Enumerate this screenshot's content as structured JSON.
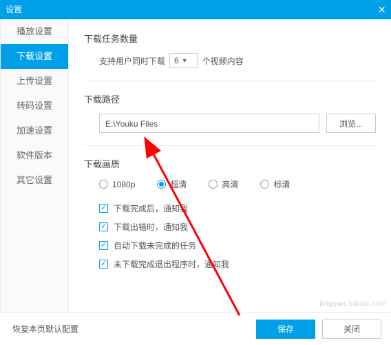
{
  "titlebar": {
    "title": "设置"
  },
  "sidebar": {
    "items": [
      {
        "label": "播放设置"
      },
      {
        "label": "下载设置"
      },
      {
        "label": "上传设置"
      },
      {
        "label": "转码设置"
      },
      {
        "label": "加速设置"
      },
      {
        "label": "软件版本"
      },
      {
        "label": "其它设置"
      }
    ],
    "active_index": 1
  },
  "download_tasks": {
    "title": "下载任务数量",
    "label_prefix": "支持用户同时下载",
    "value": "6",
    "label_suffix": "个视频内容"
  },
  "download_path": {
    "title": "下载路径",
    "value": "E:\\Youku Files",
    "browse": "浏览..."
  },
  "download_quality": {
    "title": "下载画质",
    "options": [
      {
        "label": "1080p"
      },
      {
        "label": "超清"
      },
      {
        "label": "高清"
      },
      {
        "label": "标清"
      }
    ],
    "selected_index": 1
  },
  "download_notify": {
    "items": [
      {
        "label": "下载完成后，通知我"
      },
      {
        "label": "下载出错时，通知我"
      },
      {
        "label": "自动下载未完成的任务"
      },
      {
        "label": "未下载完成退出程序时，通知我"
      }
    ]
  },
  "footer": {
    "reset": "恢复本页默认配置",
    "save": "保存",
    "close": "关闭"
  },
  "watermark": "jingyan.baidu.com"
}
